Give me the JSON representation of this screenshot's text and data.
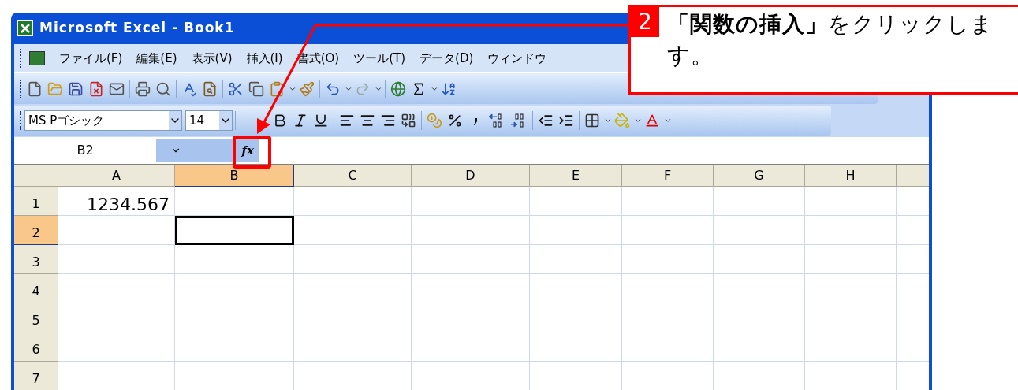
{
  "window": {
    "title": "Microsoft Excel - Book1"
  },
  "menu": [
    "ファイル(F)",
    "編集(E)",
    "表示(V)",
    "挿入(I)",
    "書式(O)",
    "ツール(T)",
    "データ(D)",
    "ウィンドウ"
  ],
  "format_toolbar": {
    "font": "MS Pゴシック",
    "size": "14"
  },
  "formula_bar": {
    "name_box": "B2",
    "function_button": "fx"
  },
  "sheet": {
    "columns": [
      {
        "label": "A",
        "selected": false
      },
      {
        "label": "B",
        "selected": true
      },
      {
        "label": "C",
        "selected": false
      },
      {
        "label": "D",
        "selected": false
      },
      {
        "label": "E",
        "selected": false
      },
      {
        "label": "F",
        "selected": false
      },
      {
        "label": "G",
        "selected": false
      },
      {
        "label": "H",
        "selected": false
      }
    ],
    "rows": [
      {
        "label": "1",
        "selected": false,
        "cells": [
          {
            "value": "1234.567",
            "selected": false
          },
          {
            "selected": false
          }
        ]
      },
      {
        "label": "2",
        "selected": true,
        "cells": [
          {
            "selected": false
          },
          {
            "selected": true
          }
        ]
      },
      {
        "label": "3",
        "selected": false
      },
      {
        "label": "4",
        "selected": false
      },
      {
        "label": "5",
        "selected": false
      },
      {
        "label": "6",
        "selected": false
      },
      {
        "label": "7",
        "selected": false
      }
    ]
  },
  "callout": {
    "step": "2",
    "text": "**「関数の挿入」**をクリックします。"
  }
}
